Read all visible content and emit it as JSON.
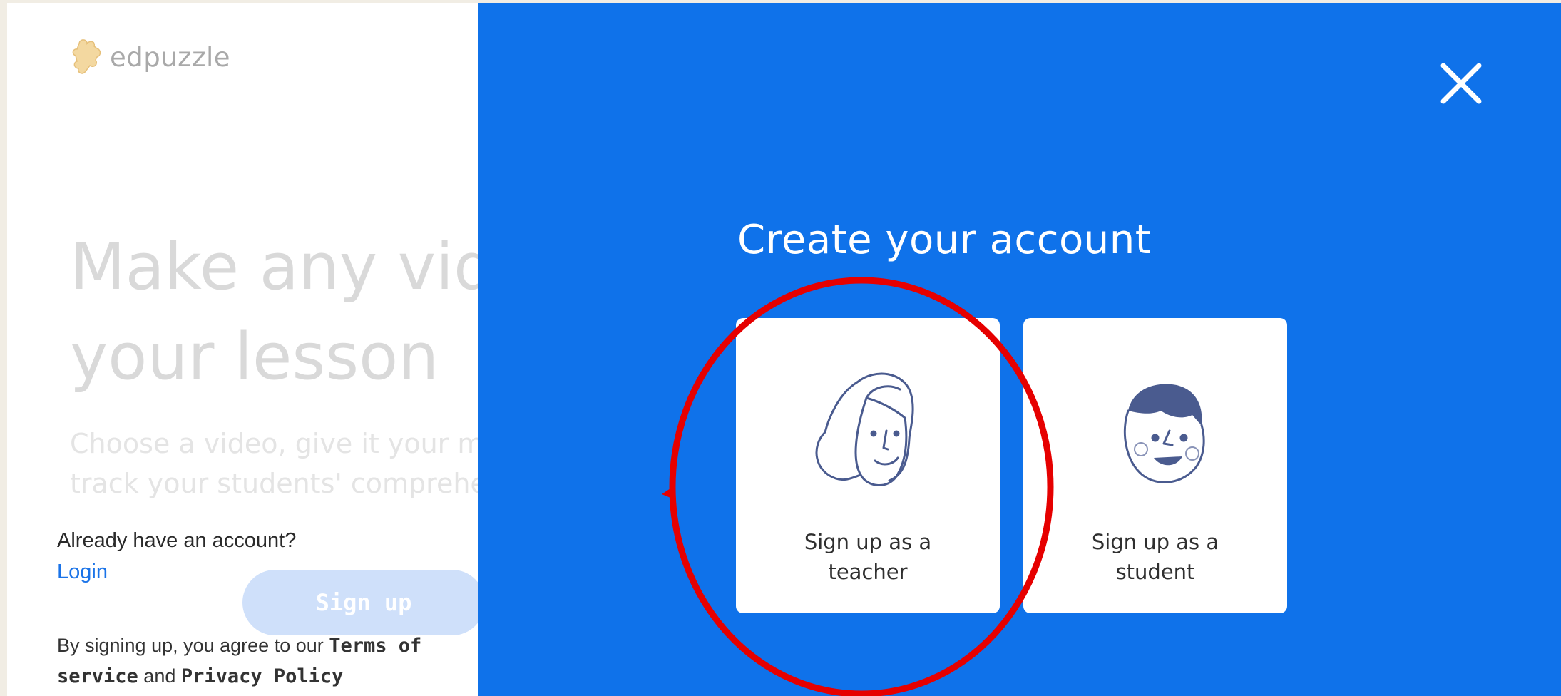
{
  "logo": {
    "text": "edpuzzle",
    "icon": "puzzle-piece-icon"
  },
  "hero": {
    "title_line1": "Make any video",
    "title_line2": "your lesson",
    "subtitle_line1": "Choose a video, give it your magic touch and",
    "subtitle_line2": "track your students' comprehension."
  },
  "login_prompt": {
    "question": "Already have an account?",
    "link": "Login"
  },
  "signup_button": "Sign up",
  "terms": {
    "prefix": "By signing up, you agree to our ",
    "terms_link": "Terms of service",
    "conjunction": " and ",
    "privacy_link": "Privacy Policy"
  },
  "modal": {
    "title": "Create your account",
    "close_icon": "close-icon",
    "options": [
      {
        "label": "Sign up as a teacher",
        "icon": "teacher-face-icon"
      },
      {
        "label": "Sign up as a student",
        "icon": "student-face-icon"
      }
    ]
  },
  "colors": {
    "panel_blue": "#0f72ea",
    "link_blue": "#1a73e8",
    "annotation_red": "#e60000",
    "illustration_navy": "#4a5b8f"
  }
}
